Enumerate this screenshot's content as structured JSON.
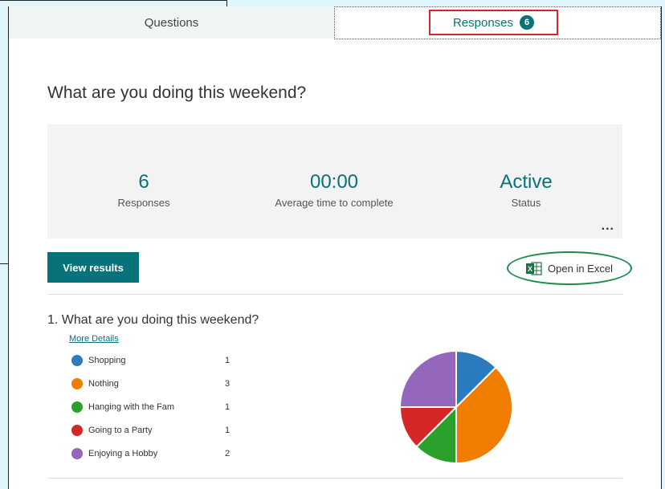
{
  "tabs": {
    "questions_label": "Questions",
    "responses_label": "Responses",
    "responses_count": "6"
  },
  "form": {
    "title": "What are you doing this weekend?"
  },
  "stats": {
    "responses": {
      "value": "6",
      "label": "Responses"
    },
    "avg_time": {
      "value": "00:00",
      "label": "Average time to complete"
    },
    "status": {
      "value": "Active",
      "label": "Status"
    },
    "more_label": "..."
  },
  "actions": {
    "view_results_label": "View results",
    "open_excel_label": "Open in Excel"
  },
  "question": {
    "title": "1.  What are you doing this weekend?",
    "more_details_label": "More Details",
    "options": [
      {
        "label": "Shopping",
        "count": "1",
        "color": "#2b7bbf"
      },
      {
        "label": "Nothing",
        "count": "3",
        "color": "#f07c00"
      },
      {
        "label": "Hanging with the Fam",
        "count": "1",
        "color": "#2ba02b"
      },
      {
        "label": "Going to a Party",
        "count": "1",
        "color": "#d62728"
      },
      {
        "label": "Enjoying a Hobby",
        "count": "2",
        "color": "#9467bd"
      }
    ]
  },
  "colors": {
    "accent": "#07727a",
    "highlight_box": "#d6262c",
    "excel_circle": "#1e8a4d"
  },
  "chart_data": {
    "type": "pie",
    "categories": [
      "Shopping",
      "Nothing",
      "Hanging with the Fam",
      "Going to a Party",
      "Enjoying a Hobby"
    ],
    "values": [
      1,
      3,
      1,
      1,
      2
    ]
  }
}
